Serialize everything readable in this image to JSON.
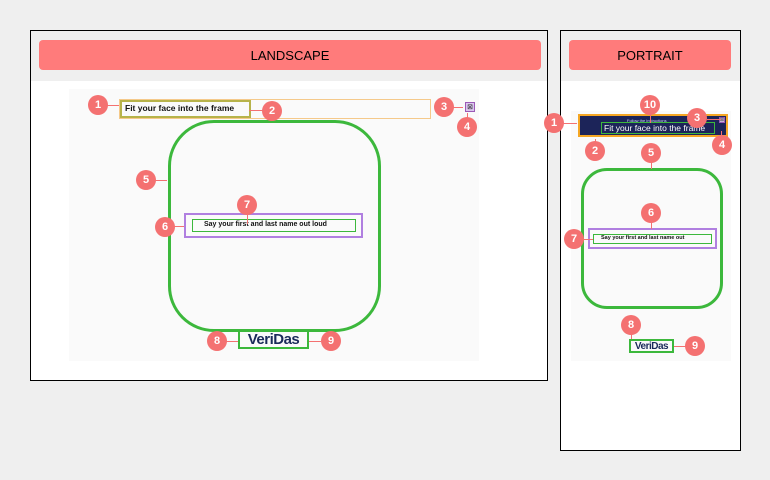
{
  "landscape": {
    "header_label": "LANDSCAPE",
    "title_text": "Fit your face into the frame",
    "prompt_text": "Say your first and last name out loud",
    "logo_text": "VeriDas",
    "close_glyph": "⊠",
    "badges": [
      "1",
      "2",
      "3",
      "4",
      "5",
      "6",
      "7",
      "8",
      "9"
    ]
  },
  "portrait": {
    "header_label": "PORTRAIT",
    "small_text": "Follow the instructions",
    "title_text": "Fit your face into the frame",
    "prompt_text": "Say your first and last name out",
    "logo_text": "VeriDas",
    "close_glyph": "⊠",
    "badges": [
      "1",
      "2",
      "3",
      "4",
      "5",
      "6",
      "7",
      "8",
      "9",
      "10"
    ]
  },
  "colors": {
    "header_button": "#ff7b7b",
    "badge": "#f47171",
    "frame_green": "#3cb83c",
    "title_outline": "#f5c98a",
    "purple_outline": "#b07fe0",
    "portrait_banner": "#1c2459"
  }
}
